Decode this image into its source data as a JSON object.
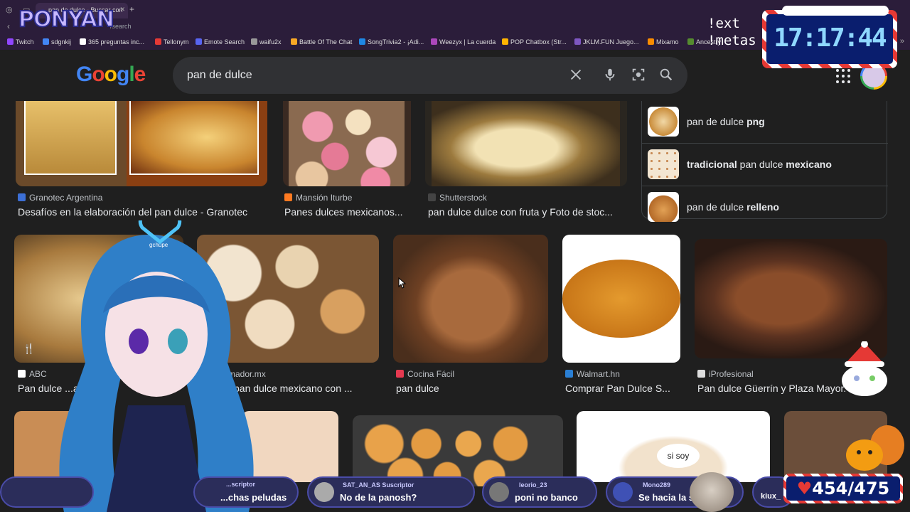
{
  "browser": {
    "tab_title": "pan de dulce - Buscar con",
    "url": "/search",
    "bookmarks": [
      "Twitch",
      "sdgnkij",
      "365 preguntas inc...",
      "Tellonym",
      "Emote Search",
      "waifu2x",
      "Battle Of The Chat",
      "SongTrivia2 - ¡Adi...",
      "Weezyx | La cuerda",
      "POP Chatbox (Str...",
      "JKLM.FUN Juego...",
      "Mixamo",
      "Ancestry"
    ]
  },
  "search": {
    "query": "pan de dulce",
    "logo": "Google"
  },
  "row1": [
    {
      "source": "Granotec Argentina",
      "title": "Desafíos en la elaboración del pan dulce - Granotec"
    },
    {
      "source": "Mansión Iturbe",
      "title": "Panes dulces mexicanos..."
    },
    {
      "source": "Shutterstock",
      "title": "pan dulce dulce con fruta y Foto de stoc..."
    }
  ],
  "related": [
    {
      "plain1": "pan de dulce ",
      "bold1": "png",
      "plain2": "",
      "bold2": ""
    },
    {
      "plain1": "",
      "bold1": "tradicional",
      "plain2": " pan dulce ",
      "bold2": "mexicano"
    },
    {
      "plain1": "pan de dulce ",
      "bold1": "relleno",
      "plain2": "",
      "bold2": ""
    }
  ],
  "row2": [
    {
      "source": "ABC",
      "title": "Pan dulce ...as. T..."
    },
    {
      "source": "Informador.mx",
      "title": "... es el pan dulce mexicano con ..."
    },
    {
      "source": "Cocina Fácil",
      "title": "pan dulce"
    },
    {
      "source": "Walmart.hn",
      "title": "Comprar Pan Dulce S..."
    },
    {
      "source": "iProfesional",
      "title": "Pan dulce Güerrín y Plaza Mayor..."
    }
  ],
  "overlay": {
    "logo": "PONYAN",
    "cmd1": "!ext",
    "cmd2": "!metas",
    "clock": "17:17:44",
    "counter": "454/475",
    "bubble": "si soy",
    "watermark": "gchupe"
  },
  "chat": [
    {
      "user": "...scriptor",
      "msg": "...chas peludas"
    },
    {
      "user": "SAT_AN_AS  Suscriptor",
      "msg": "No de la panosh?"
    },
    {
      "user": "leorio_23",
      "msg": "poni no banco"
    },
    {
      "user": "Mono289",
      "msg": "Se hacia la s..."
    },
    {
      "user": "",
      "msg": "kiux_"
    }
  ]
}
